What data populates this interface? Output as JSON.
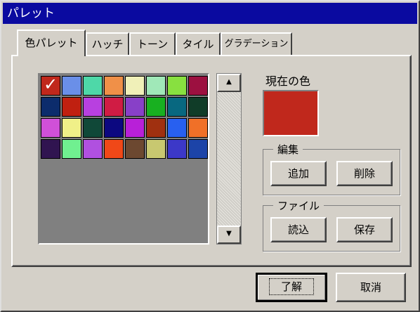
{
  "window": {
    "title": "パレット"
  },
  "tabs": [
    {
      "label": "色パレット",
      "active": true
    },
    {
      "label": "ハッチ",
      "active": false
    },
    {
      "label": "トーン",
      "active": false
    },
    {
      "label": "タイル",
      "active": false
    },
    {
      "label": "グラデーション",
      "active": false
    }
  ],
  "palette": {
    "selected_index": 0,
    "colors": [
      "#c0281c",
      "#6a8fe8",
      "#4ed8a8",
      "#f09048",
      "#f0f0b8",
      "#a0e8b8",
      "#88e040",
      "#9c1040",
      "#0c2c6c",
      "#c02010",
      "#b840e0",
      "#d01c44",
      "#8840c8",
      "#18b020",
      "#086880",
      "#103c28",
      "#d050d8",
      "#f0f088",
      "#104838",
      "#0c0880",
      "#b820d8",
      "#a03010",
      "#2860f0",
      "#f07028",
      "#301450",
      "#70f090",
      "#b050e0",
      "#f04818",
      "#6c4830",
      "#c8c870",
      "#3c38c8",
      "#1c44a8"
    ]
  },
  "scroll": {
    "up_icon": "▲",
    "down_icon": "▼"
  },
  "current_color": {
    "label": "現在の色",
    "value": "#c0281c"
  },
  "edit_group": {
    "label": "編集",
    "add": "追加",
    "delete": "削除"
  },
  "file_group": {
    "label": "ファイル",
    "load": "読込",
    "save": "保存"
  },
  "dialog_buttons": {
    "ok": "了解",
    "cancel": "取消"
  }
}
